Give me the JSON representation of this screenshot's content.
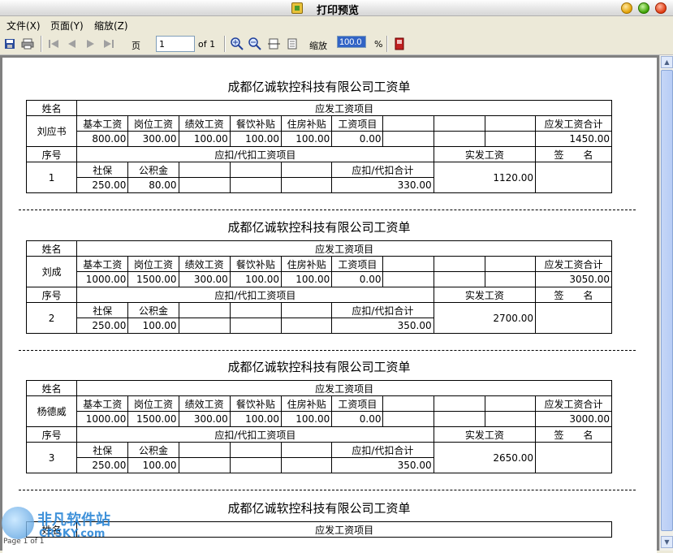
{
  "window": {
    "title": "打印预览"
  },
  "menu": [
    "文件(X)",
    "页面(Y)",
    "缩放(Z)"
  ],
  "toolbar": {
    "page_label": "页",
    "page_value": "1",
    "of_label": "of 1",
    "zoom_label": "缩放",
    "zoom_value": "100.0",
    "percent": "%"
  },
  "labels": {
    "company_title": "成都亿诚软控科技有限公司工资单",
    "name": "姓名",
    "income_section": "应发工资项目",
    "base": "基本工资",
    "post": "岗位工资",
    "perf": "绩效工资",
    "meal": "餐饮补贴",
    "housing": "住房补贴",
    "item": "工资项目",
    "gross_total": "应发工资合计",
    "seq": "序号",
    "deduct_section": "应扣/代扣工资项目",
    "net": "实发工资",
    "sign": "签　　名",
    "social": "社保",
    "fund": "公积金",
    "deduct_total": "应扣/代扣合计"
  },
  "records": [
    {
      "name": "刘应书",
      "base": "800.00",
      "post": "300.00",
      "perf": "100.00",
      "meal": "100.00",
      "housing": "100.00",
      "item": "0.00",
      "gross_total": "1450.00",
      "seq": "1",
      "social": "250.00",
      "fund": "80.00",
      "deduct_total": "330.00",
      "net": "1120.00"
    },
    {
      "name": "刘成",
      "base": "1000.00",
      "post": "1500.00",
      "perf": "300.00",
      "meal": "100.00",
      "housing": "100.00",
      "item": "0.00",
      "gross_total": "3050.00",
      "seq": "2",
      "social": "250.00",
      "fund": "100.00",
      "deduct_total": "350.00",
      "net": "2700.00"
    },
    {
      "name": "杨德威",
      "base": "1000.00",
      "post": "1500.00",
      "perf": "300.00",
      "meal": "100.00",
      "housing": "100.00",
      "item": "0.00",
      "gross_total": "3000.00",
      "seq": "3",
      "social": "250.00",
      "fund": "100.00",
      "deduct_total": "350.00",
      "net": "2650.00"
    }
  ],
  "partial_slip": {
    "name_label": "姓名",
    "income_section": "应发工资项目"
  },
  "status": {
    "page_text": "Page 1 of 1"
  },
  "watermark": {
    "cn": "非凡软件站",
    "en": "CRSKY.com"
  }
}
